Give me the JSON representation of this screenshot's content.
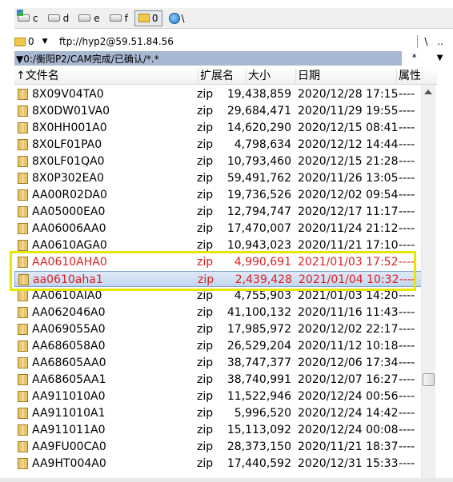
{
  "drives": [
    {
      "label": "c",
      "icon": "system-drive-icon"
    },
    {
      "label": "d",
      "icon": "drive-icon"
    },
    {
      "label": "e",
      "icon": "drive-icon"
    },
    {
      "label": "f",
      "icon": "drive-icon"
    },
    {
      "label": "0",
      "icon": "network-folder-icon"
    },
    {
      "label": "\\",
      "icon": "network-globe-icon"
    }
  ],
  "path_bar": {
    "drive": "0",
    "url": "ftp://hyp2@59.51.84.56",
    "root_btn": "\\",
    "up_btn": ".."
  },
  "dir_bar": {
    "path": "▼0:/衡阳P2/CAM完成/已确认/*.*",
    "star": "*",
    "arrow": "▼"
  },
  "columns": {
    "name": "↑文件名",
    "ext": "扩展名",
    "size": "大小",
    "date": "日期",
    "attr": "属性"
  },
  "files": [
    {
      "name": "8X09V04TA0",
      "ext": "zip",
      "size": "19,438,859",
      "date": "2020/12/28 17:15",
      "attr": "----"
    },
    {
      "name": "8X0DW01VA0",
      "ext": "zip",
      "size": "29,684,471",
      "date": "2020/11/29 19:55",
      "attr": "----"
    },
    {
      "name": "8X0HH001A0",
      "ext": "zip",
      "size": "14,620,290",
      "date": "2020/12/15 08:41",
      "attr": "----"
    },
    {
      "name": "8X0LF01PA0",
      "ext": "zip",
      "size": "4,798,634",
      "date": "2020/12/12 14:44",
      "attr": "----"
    },
    {
      "name": "8X0LF01QA0",
      "ext": "zip",
      "size": "10,793,460",
      "date": "2020/12/15 21:28",
      "attr": "----"
    },
    {
      "name": "8X0P302EA0",
      "ext": "zip",
      "size": "59,491,762",
      "date": "2020/11/26 13:05",
      "attr": "----"
    },
    {
      "name": "AA00R02DA0",
      "ext": "zip",
      "size": "19,736,526",
      "date": "2020/12/02 09:54",
      "attr": "----"
    },
    {
      "name": "AA05000EA0",
      "ext": "zip",
      "size": "12,794,747",
      "date": "2020/12/17 11:17",
      "attr": "----"
    },
    {
      "name": "AA06006AA0",
      "ext": "zip",
      "size": "17,470,007",
      "date": "2020/11/24 21:12",
      "attr": "----"
    },
    {
      "name": "AA0610AGA0",
      "ext": "zip",
      "size": "10,943,023",
      "date": "2020/11/21 17:10",
      "attr": "----"
    },
    {
      "name": "AA0610AHA0",
      "ext": "zip",
      "size": "4,990,691",
      "date": "2021/01/03 17:52",
      "attr": "----"
    },
    {
      "name": "aa0610aha1",
      "ext": "zip",
      "size": "2,439,428",
      "date": "2021/01/04 10:32",
      "attr": "----"
    },
    {
      "name": "AA0610AIA0",
      "ext": "zip",
      "size": "4,755,903",
      "date": "2021/01/03 14:20",
      "attr": "----"
    },
    {
      "name": "AA062046A0",
      "ext": "zip",
      "size": "41,100,132",
      "date": "2020/11/16 11:43",
      "attr": "----"
    },
    {
      "name": "AA069055A0",
      "ext": "zip",
      "size": "17,985,972",
      "date": "2020/12/02 22:17",
      "attr": "----"
    },
    {
      "name": "AA686058A0",
      "ext": "zip",
      "size": "26,529,204",
      "date": "2020/11/12 10:18",
      "attr": "----"
    },
    {
      "name": "AA68605AA0",
      "ext": "zip",
      "size": "38,747,377",
      "date": "2020/12/06 17:34",
      "attr": "----"
    },
    {
      "name": "AA68605AA1",
      "ext": "zip",
      "size": "38,740,991",
      "date": "2020/12/07 16:27",
      "attr": "----"
    },
    {
      "name": "AA911010A0",
      "ext": "zip",
      "size": "11,522,946",
      "date": "2020/12/24 00:56",
      "attr": "----"
    },
    {
      "name": "AA911010A1",
      "ext": "zip",
      "size": "5,996,520",
      "date": "2020/12/24 14:42",
      "attr": "----"
    },
    {
      "name": "AA911011A0",
      "ext": "zip",
      "size": "15,113,092",
      "date": "2020/12/24 00:08",
      "attr": "----"
    },
    {
      "name": "AA9FU00CA0",
      "ext": "zip",
      "size": "28,373,150",
      "date": "2020/11/21 18:37",
      "attr": "----"
    },
    {
      "name": "AA9HT004A0",
      "ext": "zip",
      "size": "17,440,592",
      "date": "2020/12/31 15:33",
      "attr": "----"
    }
  ],
  "colors": {
    "highlight_text": "#e02020",
    "highlight_box": "#e6e600",
    "selected_row_bg": "#c3d6ef",
    "path_bar_bg": "#a8b8d2"
  }
}
